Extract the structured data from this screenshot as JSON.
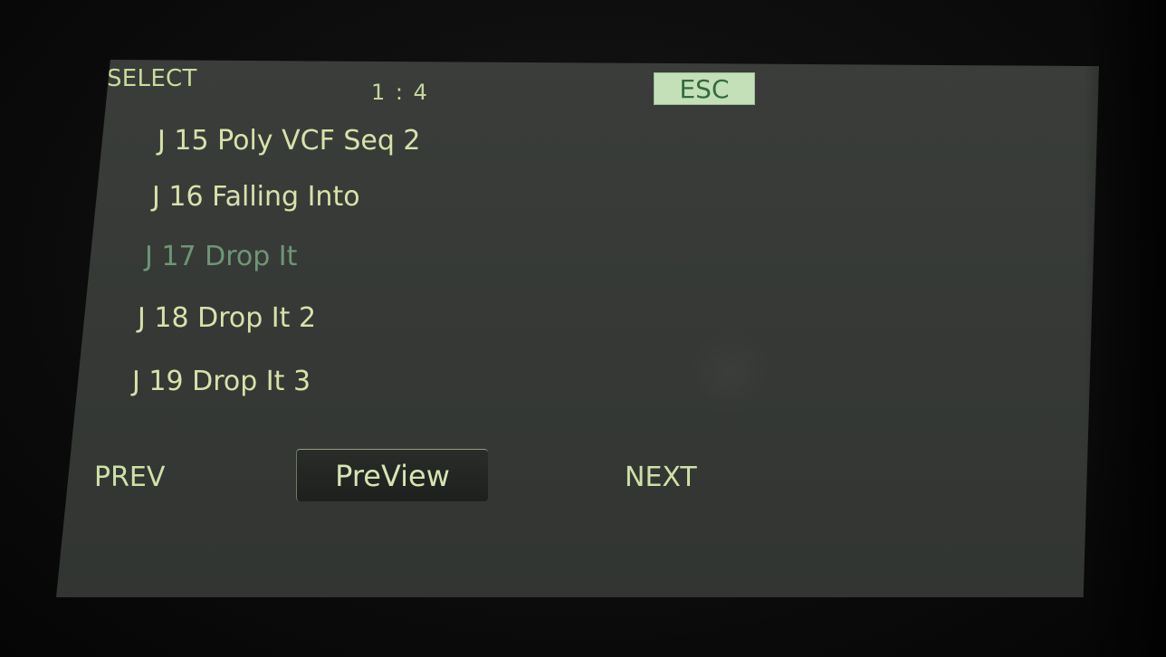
{
  "header": {
    "title": "SELECT",
    "page_indicator": "1 : 4",
    "esc_label": "ESC"
  },
  "list": {
    "items": [
      {
        "label": "J 15 Poly VCF Seq 2",
        "state": "normal"
      },
      {
        "label": "J 16 Falling Into",
        "state": "normal"
      },
      {
        "label": "J 17 Drop It",
        "state": "selected"
      },
      {
        "label": "J 18 Drop It 2",
        "state": "normal"
      },
      {
        "label": "J 19 Drop It 3",
        "state": "normal"
      }
    ]
  },
  "softkeys": {
    "prev_label": "PREV",
    "preview_label": "PreView",
    "next_label": "NEXT"
  },
  "colors": {
    "text": "#d6e2aa",
    "selected_text": "#6f9577",
    "screen_bg": "#363936",
    "esc_bg": "#c3e0b8",
    "esc_text": "#356a3f"
  }
}
